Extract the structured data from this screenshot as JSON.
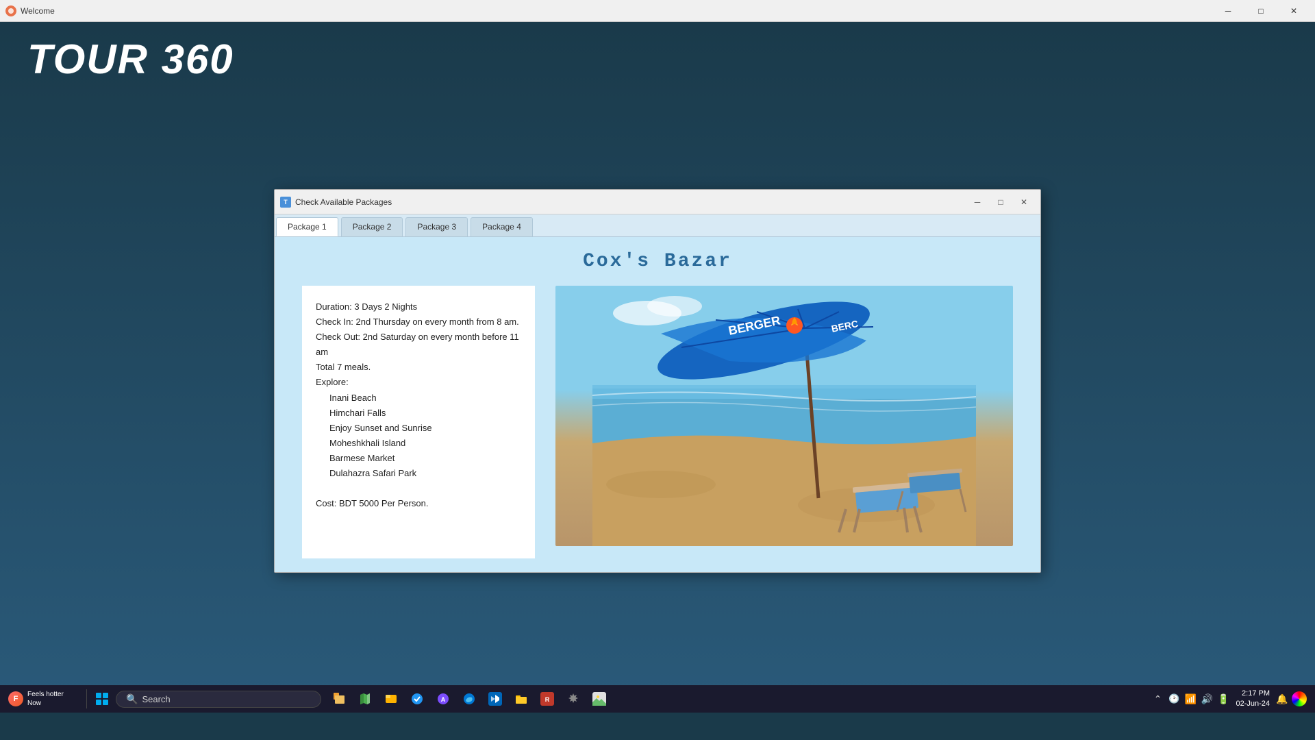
{
  "titlebar": {
    "title": "Welcome",
    "min_label": "─",
    "max_label": "□",
    "close_label": "✕"
  },
  "app": {
    "title": "TOUR  360"
  },
  "modal": {
    "title": "Check Available Packages",
    "tabs": [
      {
        "label": "Package 1",
        "active": true
      },
      {
        "label": "Package 2",
        "active": false
      },
      {
        "label": "Package 3",
        "active": false
      },
      {
        "label": "Package 4",
        "active": false
      }
    ],
    "destination": "Cox's Bazar",
    "info": {
      "duration": "Duration: 3 Days 2 Nights",
      "checkin": "Check In: 2nd Thursday on every month from 8 am.",
      "checkout": "Check Out: 2nd Saturday on every month before 11 am",
      "meals": "Total 7 meals.",
      "explore_label": "Explore:",
      "explore_items": [
        "Inani Beach",
        "Himchari Falls",
        "Enjoy Sunset and Sunrise",
        "Moheshkhali Island",
        "Barmese Market",
        "Dulahazra Safari Park"
      ],
      "cost": "Cost: BDT 5000 Per Person."
    }
  },
  "taskbar": {
    "notification": {
      "title": "Feels hotter",
      "subtitle": "Now"
    },
    "search_placeholder": "Search",
    "time": "2:17 PM",
    "date": "02-Jun-24"
  }
}
